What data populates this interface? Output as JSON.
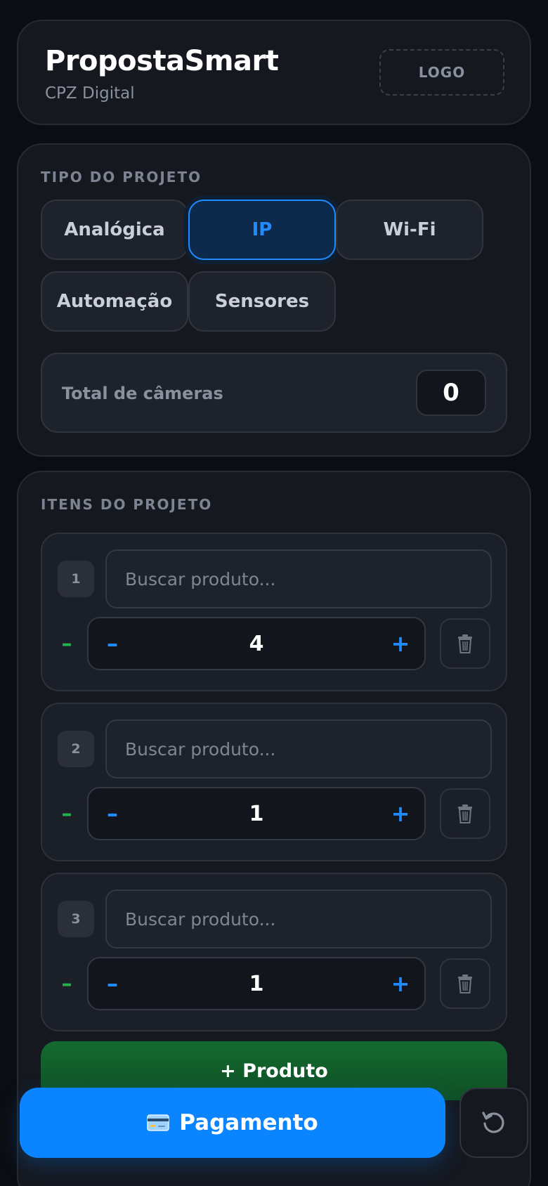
{
  "header": {
    "title": "PropostaSmart",
    "subtitle": "CPZ Digital",
    "logo_label": "LOGO"
  },
  "project_type": {
    "section_label": "TIPO DO PROJETO",
    "options": [
      {
        "label": "Analógica",
        "active": false
      },
      {
        "label": "IP",
        "active": true
      },
      {
        "label": "Wi-Fi",
        "active": false
      },
      {
        "label": "Automação",
        "active": false
      },
      {
        "label": "Sensores",
        "active": false
      }
    ],
    "total_cameras_label": "Total de câmeras",
    "total_cameras_value": "0"
  },
  "items": {
    "section_label": "ITENS DO PROJETO",
    "search_placeholder": "Buscar produto...",
    "list": [
      {
        "number": "1",
        "quantity": "4"
      },
      {
        "number": "2",
        "quantity": "1"
      },
      {
        "number": "3",
        "quantity": "1"
      }
    ],
    "minus_symbol": "–",
    "plus_symbol": "+",
    "add_product_label": "+ Produto"
  },
  "footer": {
    "payment_label": "Pagamento",
    "payment_icon": "credit-card-icon",
    "reset_icon": "reset-icon"
  },
  "colors": {
    "accent": "#0a84ff",
    "success": "#146b30",
    "background": "#0b0d12"
  }
}
